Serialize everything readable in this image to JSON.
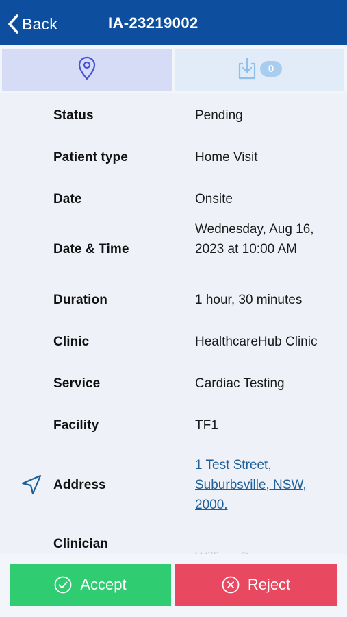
{
  "header": {
    "back_label": "Back",
    "title": "IA-23219002",
    "back_icon": "chevron-left-icon"
  },
  "tabs": [
    {
      "icon": "map-pin-icon",
      "selected": true
    },
    {
      "icon": "download-icon",
      "badge": "0",
      "selected": false
    }
  ],
  "details": [
    {
      "label": "Status",
      "value": "Pending"
    },
    {
      "label": "Patient type",
      "value": "Home Visit"
    },
    {
      "label": "Date",
      "value": "Onsite"
    },
    {
      "label": "Date & Time",
      "value_lines": [
        "Wednesday, Aug 16,",
        "2023 at 10:00 AM"
      ]
    },
    {
      "label": "Duration",
      "value": "1 hour, 30 minutes"
    },
    {
      "label": "Clinic",
      "value": "HealthcareHub Clinic"
    },
    {
      "label": "Service",
      "value": "Cardiac Testing"
    },
    {
      "label": "Facility",
      "value": "TF1"
    },
    {
      "label": "Address",
      "icon": "navigation-arrow-icon",
      "value_lines": [
        "1 Test Street,",
        "Suburbsville, NSW,",
        "2000."
      ]
    },
    {
      "label": "Clinician",
      "value": "William Brown"
    }
  ],
  "actions": {
    "accept_label": "Accept",
    "reject_label": "Reject",
    "accept_color": "#2fcc72",
    "reject_color": "#e84860"
  },
  "colors": {
    "header_bg": "#0d4f9e",
    "link": "#1f5f99",
    "selected_tab": "#d7dcf6"
  }
}
